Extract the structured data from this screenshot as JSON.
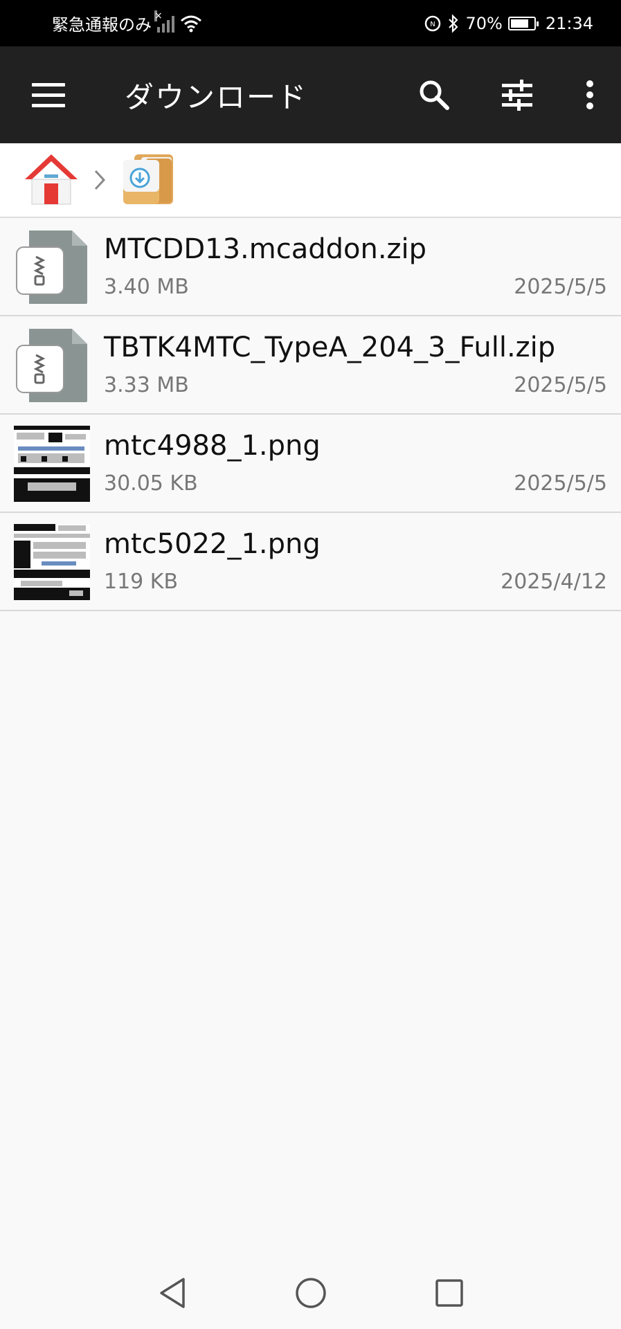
{
  "status_bar": {
    "carrier": "緊急通報のみ",
    "battery": "70%",
    "time": "21:34"
  },
  "app_bar": {
    "title": "ダウンロード"
  },
  "files": [
    {
      "name": "MTCDD13.mcaddon.zip",
      "size": "3.40 MB",
      "date": "2025/5/5",
      "type": "zip"
    },
    {
      "name": "TBTK4MTC_TypeA_204_3_Full.zip",
      "size": "3.33 MB",
      "date": "2025/5/5",
      "type": "zip"
    },
    {
      "name": "mtc4988_1.png",
      "size": "30.05 KB",
      "date": "2025/5/5",
      "type": "png"
    },
    {
      "name": "mtc5022_1.png",
      "size": "119 KB",
      "date": "2025/4/12",
      "type": "png"
    }
  ],
  "colors": {
    "app_bar": "#212121",
    "status_bar": "#000000",
    "home_red": "#e53935",
    "folder": "#e0a85a"
  }
}
